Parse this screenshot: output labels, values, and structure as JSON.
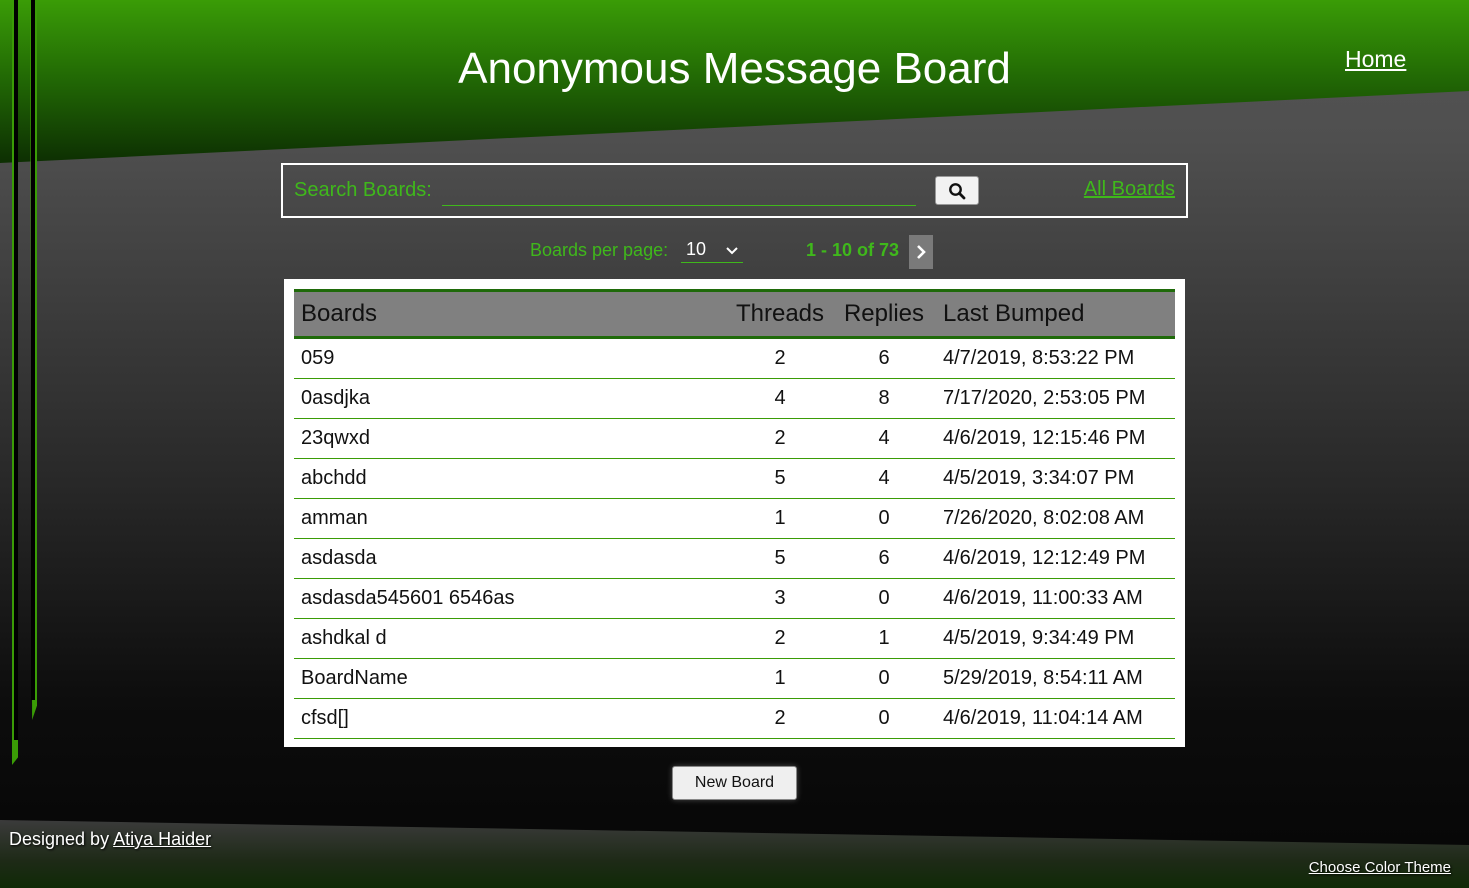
{
  "header": {
    "title": "Anonymous Message Board",
    "home_link": "Home"
  },
  "search": {
    "label": "Search Boards:",
    "value": "",
    "placeholder": "",
    "button_icon": "search-icon",
    "all_boards_link": "All Boards"
  },
  "pagination": {
    "per_page_label": "Boards per page:",
    "per_page_value": "10",
    "range_text": "1 - 10 of 73",
    "next_icon": "chevron-right-icon"
  },
  "table": {
    "headers": [
      "Boards",
      "Threads",
      "Replies",
      "Last Bumped"
    ],
    "rows": [
      {
        "board": "059",
        "threads": "2",
        "replies": "6",
        "last_bumped": "4/7/2019, 8:53:22 PM"
      },
      {
        "board": "0asdjka",
        "threads": "4",
        "replies": "8",
        "last_bumped": "7/17/2020, 2:53:05 PM"
      },
      {
        "board": "23qwxd",
        "threads": "2",
        "replies": "4",
        "last_bumped": "4/6/2019, 12:15:46 PM"
      },
      {
        "board": "abchdd",
        "threads": "5",
        "replies": "4",
        "last_bumped": "4/5/2019, 3:34:07 PM"
      },
      {
        "board": "amman",
        "threads": "1",
        "replies": "0",
        "last_bumped": "7/26/2020, 8:02:08 AM"
      },
      {
        "board": "asdasda",
        "threads": "5",
        "replies": "6",
        "last_bumped": "4/6/2019, 12:12:49 PM"
      },
      {
        "board": "asdasda545601 6546as",
        "threads": "3",
        "replies": "0",
        "last_bumped": "4/6/2019, 11:00:33 AM"
      },
      {
        "board": "ashdkal d",
        "threads": "2",
        "replies": "1",
        "last_bumped": "4/5/2019, 9:34:49 PM"
      },
      {
        "board": "BoardName",
        "threads": "1",
        "replies": "0",
        "last_bumped": "5/29/2019, 8:54:11 AM"
      },
      {
        "board": "cfsd[]",
        "threads": "2",
        "replies": "0",
        "last_bumped": "4/6/2019, 11:04:14 AM"
      }
    ]
  },
  "actions": {
    "new_board_label": "New Board"
  },
  "footer": {
    "designed_by_prefix": "Designed by",
    "designer_name": "Atiya Haider",
    "theme_link": "Choose Color Theme"
  },
  "colors": {
    "accent_green": "#3fb81b",
    "header_green": "#3a9c06",
    "table_header_bg": "#808080"
  }
}
